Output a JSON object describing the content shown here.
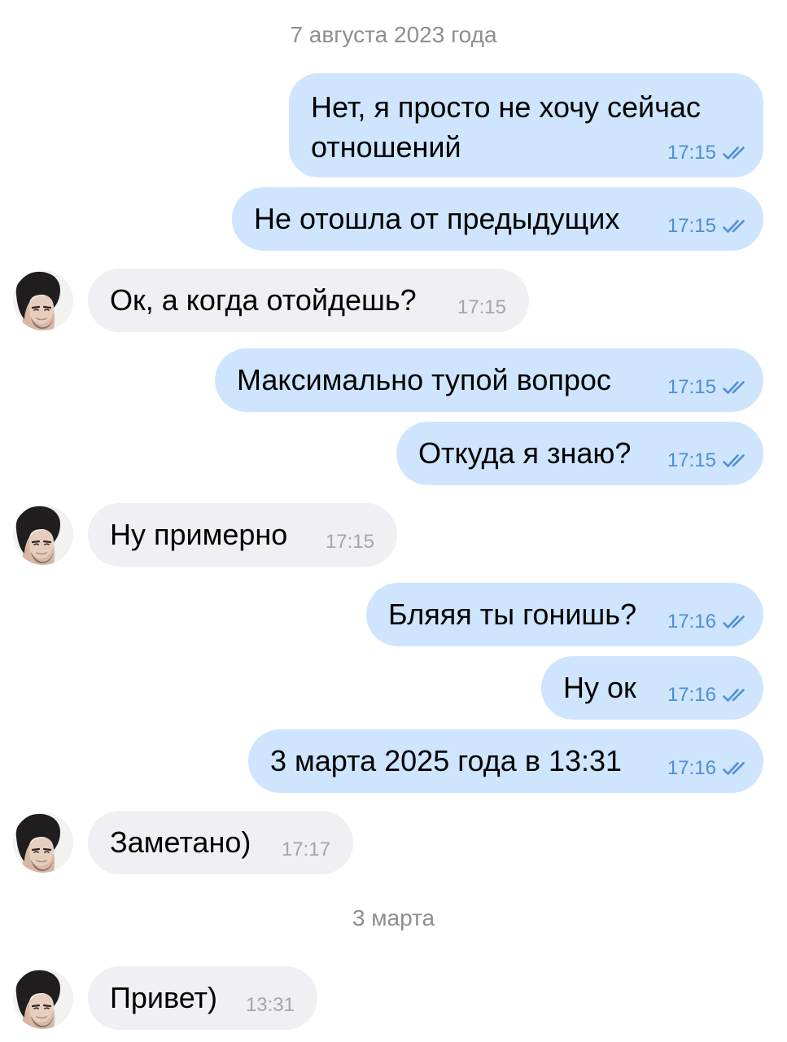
{
  "chat": {
    "date_1": "7 августа 2023 года",
    "date_2": "3 марта",
    "messages": [
      {
        "text": "Нет, я просто не хочу сейчас отношений",
        "text_line_1": "Нет, я просто не хочу сейчас",
        "text_line_2": "отношений",
        "time": "17:15",
        "direction": "outgoing",
        "read": true
      },
      {
        "text": "Не отошла от предыдущих",
        "time": "17:15",
        "direction": "outgoing",
        "read": true
      },
      {
        "text": "Ок, а когда отойдешь?",
        "time": "17:15",
        "direction": "incoming"
      },
      {
        "text": "Максимально тупой вопрос",
        "time": "17:15",
        "direction": "outgoing",
        "read": true
      },
      {
        "text": "Откуда я знаю?",
        "time": "17:15",
        "direction": "outgoing",
        "read": true
      },
      {
        "text": "Ну примерно",
        "time": "17:15",
        "direction": "incoming"
      },
      {
        "text": "Бляяя ты гонишь?",
        "time": "17:16",
        "direction": "outgoing",
        "read": true
      },
      {
        "text": "Ну ок",
        "time": "17:16",
        "direction": "outgoing",
        "read": true
      },
      {
        "text": "3 марта 2025 года в 13:31",
        "time": "17:16",
        "direction": "outgoing",
        "read": true
      },
      {
        "text": "Заметано)",
        "time": "17:17",
        "direction": "incoming"
      },
      {
        "text": "Привет)",
        "time": "13:31",
        "direction": "incoming"
      }
    ]
  },
  "icons": {
    "read_receipt": "double-check-icon",
    "avatar": "contact-avatar"
  },
  "colors": {
    "outgoing_bubble": "#cfe5fd",
    "incoming_bubble": "#efeff4",
    "outgoing_time": "#4d8fd6",
    "incoming_time": "#a5a5aa",
    "date_separator": "#8e8e93"
  }
}
